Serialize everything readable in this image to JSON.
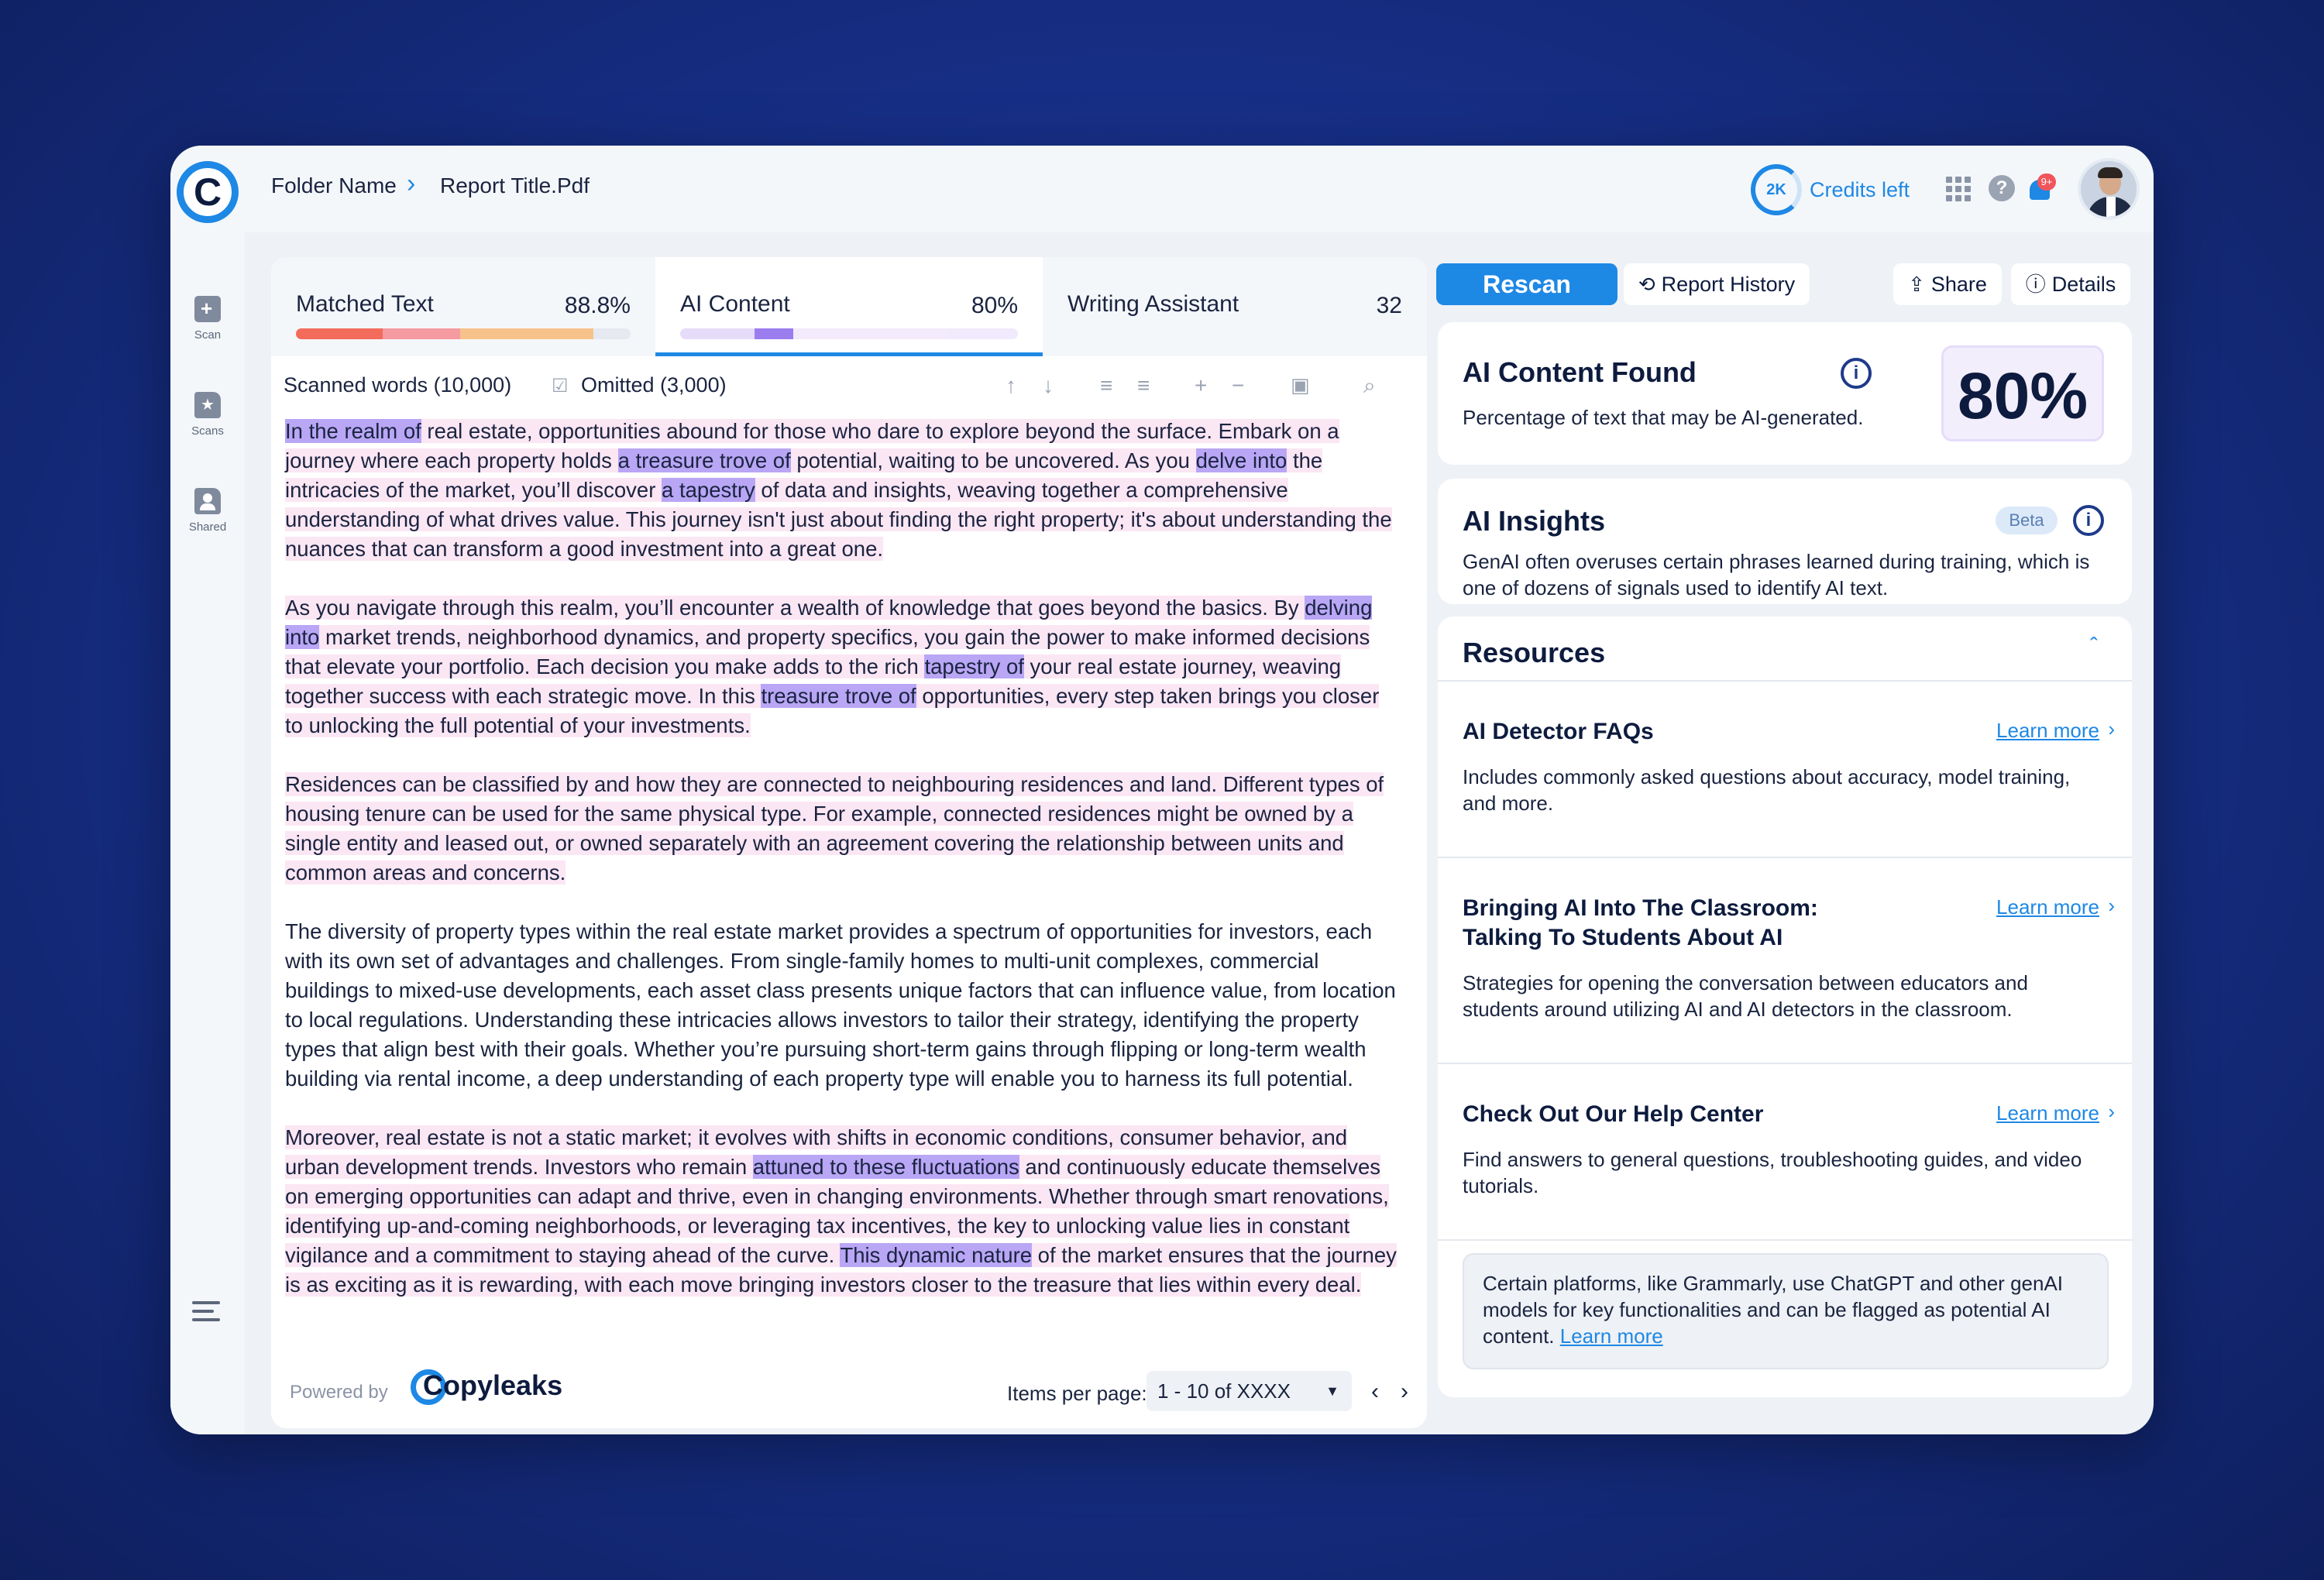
{
  "header": {
    "breadcrumb_folder": "Folder Name",
    "breadcrumb_file": "Report Title.Pdf",
    "credits_value": "2K",
    "credits_label": "Credits left",
    "notification_badge": "9+"
  },
  "sidebar": {
    "items": [
      {
        "label": "Scan",
        "icon": "scan-file-icon"
      },
      {
        "label": "Scans",
        "icon": "folder-star-icon"
      },
      {
        "label": "Shared",
        "icon": "folder-user-icon"
      }
    ]
  },
  "tabs": [
    {
      "label": "Matched Text",
      "value": "88.8%",
      "progress": 0.888
    },
    {
      "label": "AI Content",
      "value": "80%",
      "progress": 0.8
    },
    {
      "label": "Writing Assistant",
      "value": "32"
    }
  ],
  "toolbar": {
    "scanned_words": "Scanned words (10,000)",
    "omitted": "Omitted (3,000)"
  },
  "document": {
    "p1": {
      "s1": "In the realm of",
      "t1": " real estate, opportunities abound for those who dare to explore beyond the surface. Embark on a journey where each property holds ",
      "s2": "a treasure trove of",
      "t2": " potential, waiting to be uncovered. As you ",
      "s3": "delve into",
      "t3": " the intricacies of the market, you’ll discover ",
      "s4": "a tapestry",
      "t4": " of data and insights, weaving together a comprehensive understanding of what drives value. This journey isn't just about finding the right property; it's about understanding the nuances that can transform a good investment into a great one."
    },
    "p2": {
      "t0": "As you navigate through this realm, you’ll encounter a wealth of knowledge that goes beyond the basics. By ",
      "s1": "delving into",
      "t1": " market trends, neighborhood dynamics, and property specifics, you gain the power to make informed decisions that elevate your portfolio. Each decision you make adds to the rich ",
      "s2": "tapestry of",
      "t2": " your real estate journey, weaving together success with each strategic move. In this ",
      "s3": "treasure trove of",
      "t3": " opportunities, every step taken brings you closer to unlocking the full potential of your investments."
    },
    "p3": "Residences can be classified by and how they are connected to neighbouring residences and land. Different types of housing tenure can be used for the same physical type. For example, connected residences might be owned by a single entity and leased out, or owned separately with an agreement covering the relationship between units and common areas and concerns.",
    "p4": "The diversity of property types within the real estate market provides a spectrum of opportunities for investors, each with its own set of advantages and challenges. From single-family homes to multi-unit complexes, commercial buildings to mixed-use developments, each asset class presents unique factors that can influence value, from location to local regulations. Understanding these intricacies allows investors to tailor their strategy, identifying the property types that align best with their goals. Whether you’re pursuing short-term gains through flipping or long-term wealth building via rental income, a deep understanding of each property type will enable you to harness its full potential.",
    "p5": {
      "t0": "Moreover, real estate is not a static market; it evolves with shifts in economic conditions, consumer behavior, and urban development trends. Investors who remain ",
      "s1": "attuned to these fluctuations",
      "t1": " and continuously educate themselves on emerging opportunities can adapt and thrive, even in changing environments. Whether through smart renovations, identifying up-and-coming neighborhoods, or leveraging tax incentives, the key to unlocking value lies in constant vigilance and a commitment to staying ahead of the curve. ",
      "s2": "This dynamic nature",
      "t2": " of the market ensures that the journey is as exciting as it is rewarding, with each move bringing investors closer to the treasure that lies within every deal."
    }
  },
  "footer": {
    "powered_by": "Powered by",
    "brand": "Copyleaks",
    "items_per_page_label": "Items per page:",
    "pager_value": "1 - 10 of XXXX"
  },
  "actions": {
    "rescan": "Rescan",
    "report_history": "Report History",
    "share": "Share",
    "details": "Details"
  },
  "ai_content_card": {
    "title": "AI Content Found",
    "description": "Percentage of text that may be AI-generated.",
    "score": "80%"
  },
  "ai_insights_card": {
    "title": "AI Insights",
    "badge": "Beta",
    "description": "GenAI often overuses certain phrases learned during training, which is one of dozens of signals used to identify AI text."
  },
  "resources": {
    "title": "Resources",
    "learn_more": "Learn more",
    "items": [
      {
        "title": "AI Detector FAQs",
        "description": "Includes commonly asked questions about accuracy, model training, and more."
      },
      {
        "title_line1": "Bringing AI Into The Classroom:",
        "title_line2": "Talking To Students About AI",
        "description": "Strategies for opening the conversation between educators and students around utilizing AI and AI detectors in the classroom."
      },
      {
        "title": "Check Out Our Help Center",
        "description": "Find answers to general questions, troubleshooting guides, and video tutorials."
      }
    ],
    "note_text": "Certain platforms, like Grammarly, use ChatGPT and other genAI models for key functionalities and can be flagged as potential AI content.",
    "note_link": "Learn more"
  },
  "colors": {
    "accent": "#1e88e5",
    "highlight_light": "#fbe6f3",
    "highlight_strong": "#b9a6f5",
    "matched_bar": [
      "#f26b5b",
      "#f49aa0",
      "#f7c289"
    ],
    "ai_bar": [
      "#9b7df0",
      "#e6dcfa"
    ]
  }
}
